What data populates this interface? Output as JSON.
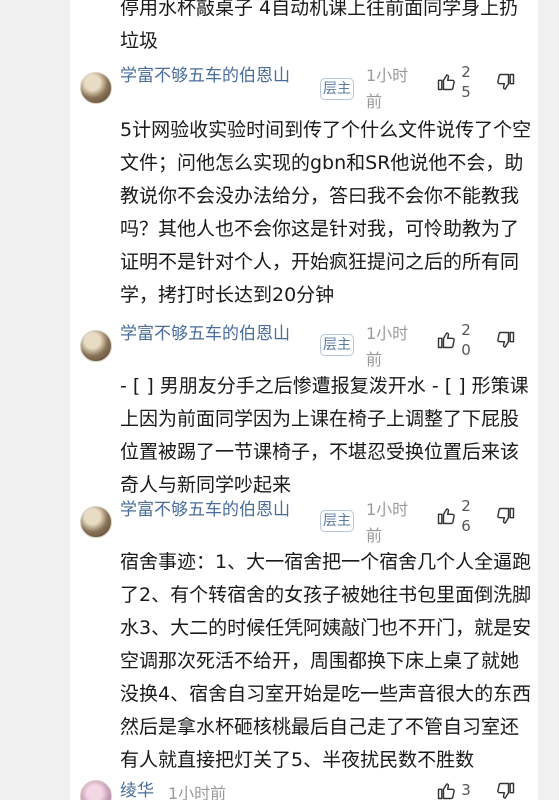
{
  "lead": {
    "text": "停用水杯敲桌子 4自动机课上往前面同学身上扔垃圾"
  },
  "comments": [
    {
      "username": "学富不够五车的伯恩山",
      "badge": "层主",
      "time": "1小时前",
      "likes": "25",
      "body": "5计网验收实验时间到传了个什么文件说传了个空文件；问他怎么实现的gbn和SR他说他不会，助教说你不会没办法给分，答曰我不会你不能教我吗？其他人也不会你这是针对我，可怜助教为了证明不是针对个人，开始疯狂提问之后的所有同学，拷打时长达到20分钟"
    },
    {
      "username": "学富不够五车的伯恩山",
      "badge": "层主",
      "time": "1小时前",
      "likes": "20",
      "body": "- [ ] 男朋友分手之后惨遭报复泼开水 - [ ] 形策课上因为前面同学因为上课在椅子上调整了下屁股位置被踢了一节课椅子，不堪忍受换位置后来该奇人与新同学吵起来"
    },
    {
      "username": "学富不够五车的伯恩山",
      "badge": "层主",
      "time": "1小时前",
      "likes": "26",
      "body": "宿舍事迹：1、大一宿舍把一个宿舍几个人全逼跑了2、有个转宿舍的女孩子被她往书包里面倒洗脚水3、大二的时候任凭阿姨敲门也不开门，就是安空调那次死活不给开，周围都换下床上桌了就她没换4、宿舍自习室开始是吃一些声音很大的东西然后是拿水杯砸核桃最后自己走了不管自习室还有人就直接把灯关了5、半夜扰民数不胜数"
    },
    {
      "username": "绫华",
      "time": "1小时前",
      "likes": "3"
    }
  ],
  "icons": {
    "like": "thumbs-up-icon",
    "dislike": "thumbs-down-icon"
  },
  "colors": {
    "username": "#4a6d9a",
    "badge_border": "#b8c6d8",
    "meta_gray": "#9a9a9a"
  }
}
